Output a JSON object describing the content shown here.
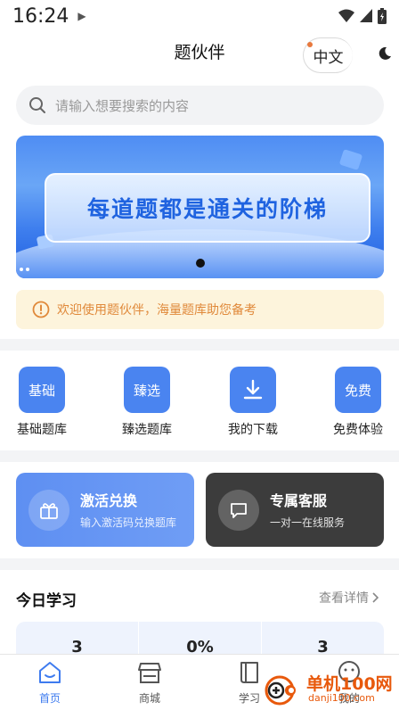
{
  "status_bar": {
    "time": "16:24"
  },
  "header": {
    "title": "题伙伴",
    "lang_label": "中文"
  },
  "search": {
    "placeholder": "请输入想要搜索的内容"
  },
  "banner": {
    "text": "每道题都是通关的阶梯"
  },
  "notice": {
    "text": "欢迎使用题伙伴，海量题库助您备考"
  },
  "quick_links": [
    {
      "icon_text": "基础",
      "label": "基础题库"
    },
    {
      "icon_text": "臻选",
      "label": "臻选题库"
    },
    {
      "icon_text": "",
      "icon": "download-icon",
      "label": "我的下载"
    },
    {
      "icon_text": "免费",
      "label": "免费体验"
    }
  ],
  "actions": {
    "activate": {
      "title": "激活兑换",
      "subtitle": "输入激活码兑换题库"
    },
    "service": {
      "title": "专属客服",
      "subtitle": "一对一在线服务"
    }
  },
  "today": {
    "title": "今日学习",
    "more_label": "查看详情",
    "stats": [
      "3",
      "0%",
      "3"
    ]
  },
  "tabbar": [
    {
      "label": "首页",
      "icon": "home-icon",
      "active": true
    },
    {
      "label": "商城",
      "icon": "store-icon",
      "active": false
    },
    {
      "label": "学习",
      "icon": "book-icon",
      "active": false
    },
    {
      "label": "我的",
      "icon": "profile-icon",
      "active": false
    }
  ],
  "watermark": {
    "title": "单机100网",
    "url": "danji100.com"
  },
  "colors": {
    "accent": "#4a84f0",
    "notice_text": "#e0893a",
    "dark_card": "#3c3c3c"
  }
}
